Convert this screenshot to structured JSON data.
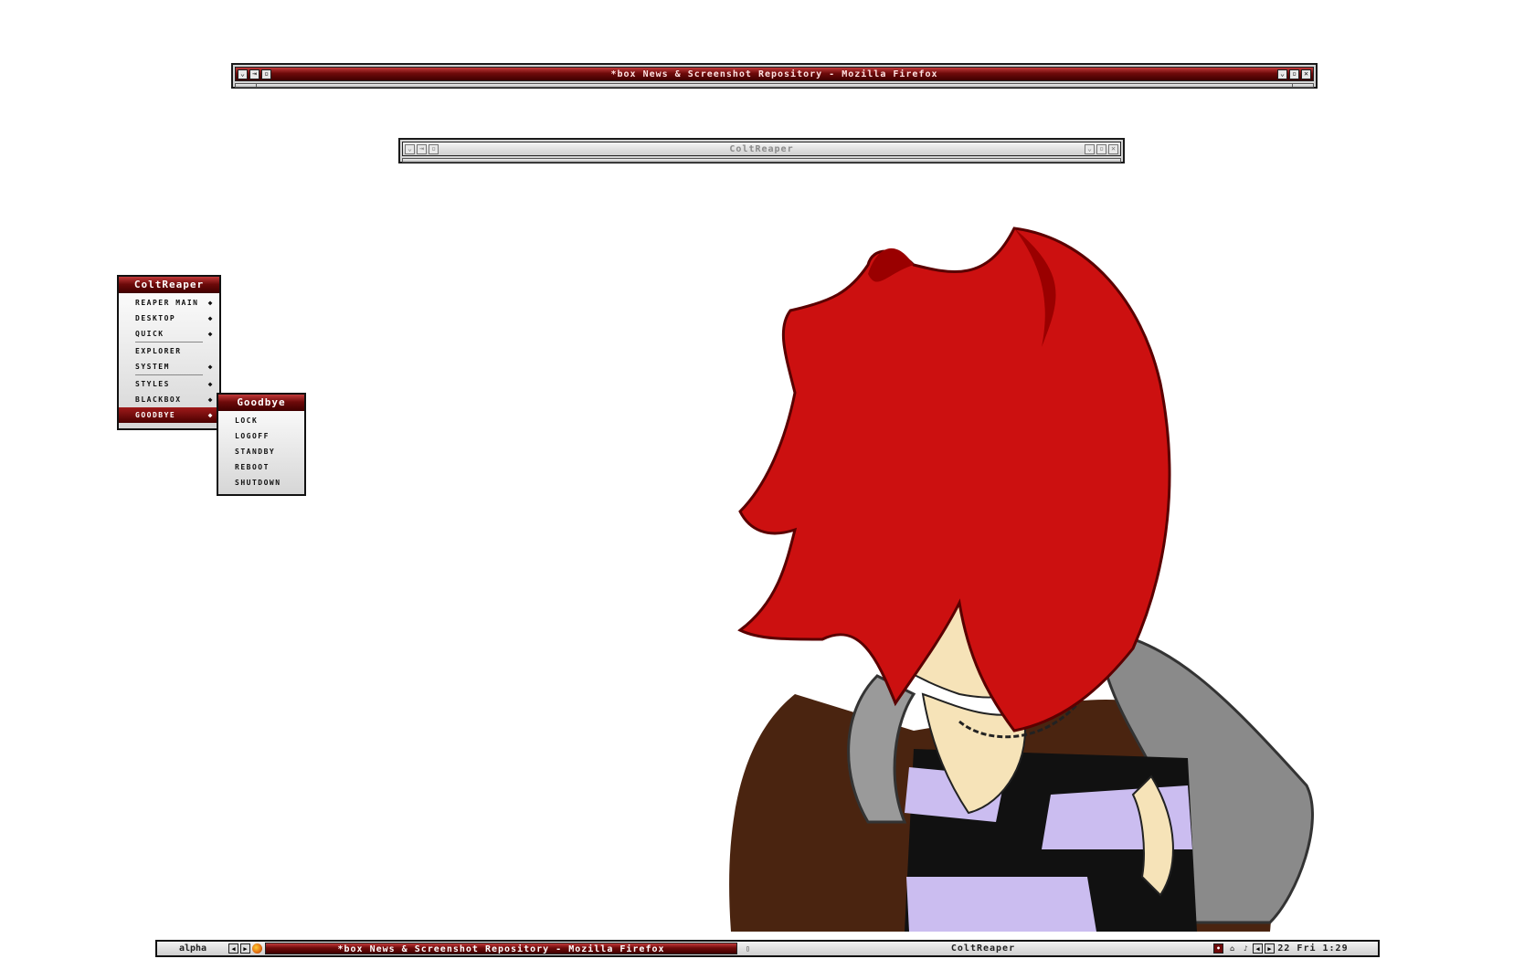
{
  "firefox_window": {
    "title": "*box News & Screenshot Repository - Mozilla Firefox",
    "left_buttons": [
      "chevron-down-icon",
      "stick-icon",
      "iconify-icon"
    ],
    "right_buttons": [
      "shade-icon",
      "maximize-icon",
      "close-icon"
    ]
  },
  "terminal_window": {
    "title": "ColtReaper",
    "left_buttons": [
      "chevron-down-icon",
      "stick-icon",
      "iconify-icon"
    ],
    "right_buttons": [
      "shade-icon",
      "maximize-icon",
      "close-icon"
    ]
  },
  "root_menu": {
    "title": "ColtReaper",
    "items": [
      {
        "label": "REAPER MAIN",
        "has_submenu": true
      },
      {
        "label": "DESKTOP",
        "has_submenu": true
      },
      {
        "label": "QUICK",
        "has_submenu": true
      },
      {
        "label": "EXPLORER",
        "has_submenu": false
      },
      {
        "label": "SYSTEM",
        "has_submenu": true
      },
      {
        "label": "STYLES",
        "has_submenu": true
      },
      {
        "label": "BLACKBOX",
        "has_submenu": true
      },
      {
        "label": "GOODBYE",
        "has_submenu": true,
        "selected": true
      }
    ]
  },
  "goodbye_menu": {
    "title": "Goodbye",
    "items": [
      "LOCK",
      "LOGOFF",
      "STANDBY",
      "REBOOT",
      "SHUTDOWN"
    ]
  },
  "toolbar": {
    "workspace": "alpha",
    "tasks": [
      {
        "title": "*box News & Screenshot Repository - Mozilla Firefox",
        "active": true
      },
      {
        "title": "ColtReaper",
        "active": false
      }
    ],
    "clock": "22 Fri 1:29"
  },
  "colors": {
    "accent_red": "#6e0a0a",
    "frame": "#1a1a1a",
    "menu_bg": "#ffffff"
  }
}
